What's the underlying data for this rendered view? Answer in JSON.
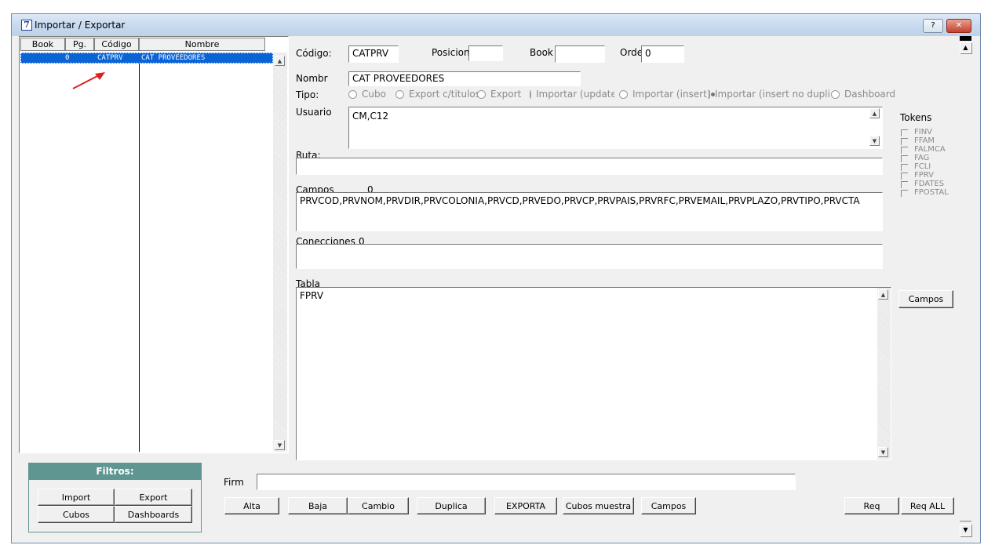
{
  "window": {
    "title": "Importar / Exportar",
    "help_label": "?",
    "close_label": "✕",
    "app_icon_glyph": "7"
  },
  "grid": {
    "columns": [
      "Book",
      "Pg.",
      "Código",
      "Nombre"
    ],
    "rows": [
      {
        "book": "",
        "pg": "0",
        "codigo": "CATPRV",
        "nombre": "CAT PROVEEDORES"
      }
    ]
  },
  "form": {
    "codigo_label": "Código:",
    "codigo_value": "CATPRV",
    "posicion_label": "Posicion:",
    "posicion_value": "",
    "book_label": "Book",
    "book_value": "",
    "orden_label": "Orde",
    "orden_value": "0",
    "nombre_label": "Nombr",
    "nombre_value": "CAT PROVEEDORES",
    "tipo_label": "Tipo:",
    "tipo_options": [
      "Cubo",
      "Export c/titulos",
      "Export",
      "Importar (update)",
      "Importar (insert)",
      "Importar (insert no duplica",
      "Dashboard"
    ],
    "tipo_selected": "Importar (insert no duplica",
    "usuario_label": "Usuario",
    "usuario_value": "CM,C12",
    "ruta_label": "Ruta:",
    "ruta_value": "",
    "campos_label": "Campos",
    "campos_count": "0",
    "campos_value": "PRVCOD,PRVNOM,PRVDIR,PRVCOLONIA,PRVCD,PRVEDO,PRVCP,PRVPAIS,PRVRFC,PRVEMAIL,PRVPLAZO,PRVTIPO,PRVCTA",
    "conecciones_label": "Conecciones",
    "conecciones_count": "0",
    "conecciones_value": "",
    "tabla_label": "Tabla",
    "tabla_value": "FPRV",
    "firm_label": "Firm",
    "firm_value": ""
  },
  "tokens": {
    "title": "Tokens",
    "items": [
      "FINV",
      "FFAM",
      "FALMCA",
      "FAG",
      "FCLI",
      "FPRV",
      "FDATES",
      "FPOSTAL"
    ]
  },
  "campos_side_button": "Campos",
  "filtros": {
    "title": "Filtros:",
    "buttons": [
      "Import",
      "Export",
      "Cubos",
      "Dashboards"
    ]
  },
  "bottom_buttons": [
    "Alta",
    "Baja",
    "Cambio",
    "Duplica",
    "EXPORTA",
    "Cubos muestra",
    "Campos"
  ],
  "req_buttons": [
    "Req",
    "Req ALL"
  ],
  "colors": {
    "selection": "#0a64d6",
    "filtros_header": "#5f9692",
    "arrow": "#e02020"
  }
}
